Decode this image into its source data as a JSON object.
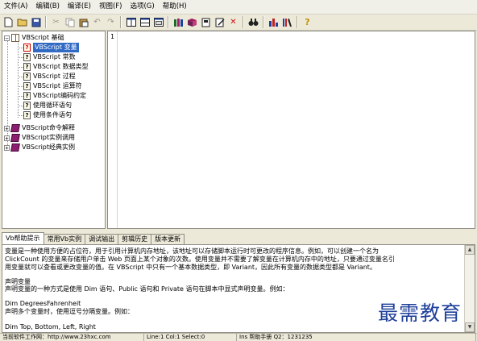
{
  "menubar": {
    "items": [
      "文件(A)",
      "编辑(B)",
      "编译(E)",
      "视图(F)",
      "选项(G)",
      "帮助(H)"
    ]
  },
  "toolbar": {
    "icons": [
      "new-file-icon",
      "open-folder-icon",
      "save-icon",
      "cut-icon",
      "copy-icon",
      "paste-icon",
      "undo-icon",
      "redo-icon",
      "layout-split-icon",
      "layout-horizontal-icon",
      "layout-window-icon",
      "books-icon",
      "manual-icon",
      "page-icon",
      "edit-page-icon",
      "delete-icon",
      "find-icon",
      "chart-icon",
      "library-icon",
      "help-icon"
    ]
  },
  "tree": {
    "root_label": "VBScript 基础",
    "root_expander": "−",
    "children": [
      "VBScript 变量",
      "VBScript 常数",
      "VBScript 数据类型",
      "VBScript 过程",
      "VBScript 运算符",
      "VBScript编码约定",
      "使用循环语句",
      "使用条件语句"
    ],
    "collapsed": [
      "VBScript命令解释",
      "VBScript实例调用",
      "VBScript经典实例"
    ],
    "collapsed_expander": "+",
    "leaf_mark": "?"
  },
  "editor": {
    "line_number": "1"
  },
  "tabs": [
    "Vb帮助提示",
    "常用Vb实例",
    "调试输出",
    "剪辑历史",
    "版本更新"
  ],
  "output": {
    "lines": [
      "变量是一种使用方便的占位符，用于引用计算机内存地址，该地址可以存储脚本运行时可更改的程序信息。例如，可以创建一个名为",
      "ClickCount 的变量来存储用户单击 Web 页面上某个对象的次数。使用变量并不需要了解变量在计算机内存中的地址，只要通过变量名引",
      "用变量就可以查看或更改变量的值。在 VBScript 中只有一个基本数据类型，即 Variant，因此所有变量的数据类型都是 Variant。",
      "",
      "声明变量",
      "声明变量的一种方式是使用 Dim 语句、Public 语句和 Private 语句在脚本中显式声明变量。例如：",
      "",
      "Dim DegreesFahrenheit",
      "声明多个变量时，使用逗号分隔变量。例如：",
      "",
      "Dim Top, Bottom, Left, Right"
    ]
  },
  "statusbar": {
    "panels": [
      "当前软件工作网：http://www.23hxc.com",
      "Line:1  Col:1  Select:0",
      "Ins  帮助手册 Q2：1231235"
    ]
  },
  "watermark": {
    "text": "最需教育"
  }
}
